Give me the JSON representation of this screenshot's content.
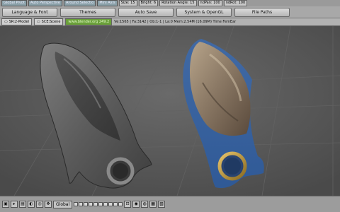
{
  "prefs_bar": {
    "global_pivot": "Global Pivot",
    "auto_perspective": "Auto Perspective",
    "around_selection": "Around Selectio",
    "mini_axis": "Mini Axis",
    "size": "Size: 15",
    "bright": "Bright: 6",
    "rotation_angle": "Rotation Angle: 15",
    "ndpan": "ndPan: 100",
    "ndrot": "ndRot: 100"
  },
  "tabs": [
    {
      "label": "Language & Font"
    },
    {
      "label": "Themes"
    },
    {
      "label": "Auto Save"
    },
    {
      "label": "System & OpenGL"
    },
    {
      "label": "File Paths"
    }
  ],
  "info_bar": {
    "screen": "SR:2-Model",
    "scene": "SCE:Scene",
    "url": "www.blender.org 249.2",
    "stats": "Ve:1565 | Fa:3142 | Ob:1-1 | La:0    Mem:2.54M (16.09M)   Time   FemEar"
  },
  "bottom_bar": {
    "orientation": "Global"
  },
  "colors": {
    "viewport_bg": "#545454",
    "accent_green": "#6aa03a"
  }
}
